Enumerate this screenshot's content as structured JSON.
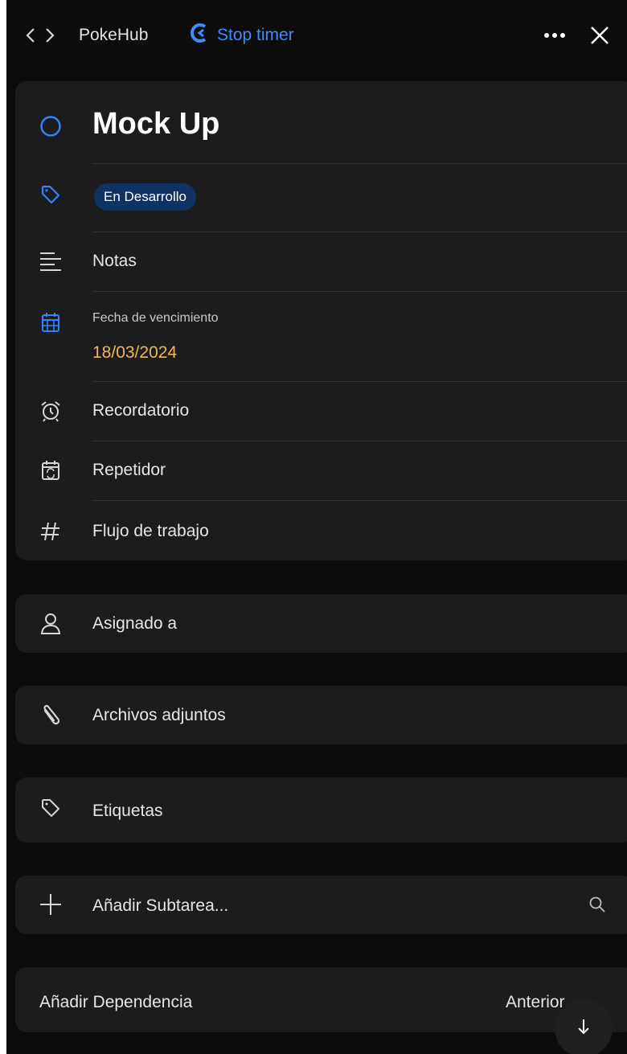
{
  "header": {
    "app_name": "PokeHub",
    "timer_label": "Stop timer",
    "icons": [
      "nav-arrows-icon",
      "timer-icon",
      "more-icon",
      "close-icon"
    ]
  },
  "task": {
    "title": "Mock Up",
    "status_label": "En Desarrollo",
    "notes_label": "Notas",
    "due_date_label": "Fecha de vencimiento",
    "due_date_value": "18/03/2024",
    "reminder_label": "Recordatorio",
    "repeat_label": "Repetidor",
    "workflow_label": "Flujo de trabajo"
  },
  "assigned": {
    "label": "Asignado a"
  },
  "attachments": {
    "label": "Archivos adjuntos"
  },
  "tags": {
    "label": "Etiquetas"
  },
  "subtask": {
    "label": "Añadir Subtarea..."
  },
  "dependency": {
    "label": "Añadir Dependencia",
    "value": "Anterior"
  },
  "colors": {
    "background": "#0c0c0c",
    "card": "#1c1c1e",
    "accent": "#3b8cff",
    "date": "#f1b84d",
    "pill_bg": "#0f3263"
  }
}
